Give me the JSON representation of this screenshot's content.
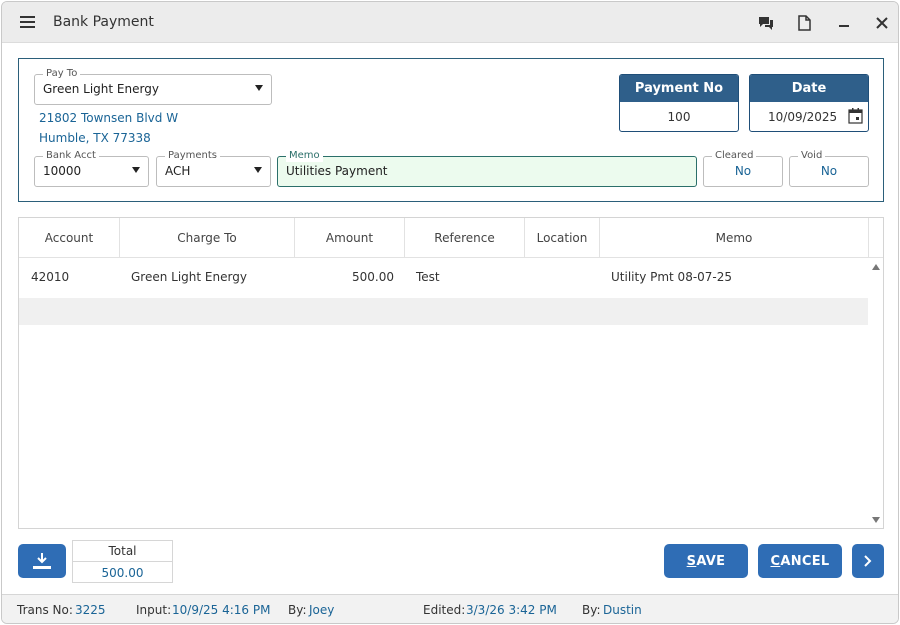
{
  "window": {
    "title": "Bank Payment"
  },
  "pay_to": {
    "legend": "Pay To",
    "value": "Green Light Energy",
    "address_line1": "21802 Townsen Blvd W",
    "address_line2": "Humble, TX 77338"
  },
  "payment_no": {
    "label": "Payment No",
    "value": "100"
  },
  "date": {
    "label": "Date",
    "value": "10/09/2025"
  },
  "bank_acct": {
    "legend": "Bank Acct",
    "value": "10000"
  },
  "payments": {
    "legend": "Payments",
    "value": "ACH"
  },
  "memo": {
    "legend": "Memo",
    "value": "Utilities Payment"
  },
  "cleared": {
    "legend": "Cleared",
    "value": "No"
  },
  "void": {
    "legend": "Void",
    "value": "No"
  },
  "grid": {
    "columns": [
      "Account",
      "Charge To",
      "Amount",
      "Reference",
      "Location",
      "Memo"
    ],
    "rows": [
      {
        "account": "42010",
        "charge_to": "Green Light Energy",
        "amount": "500.00",
        "reference": "Test",
        "location": "",
        "memo": "Utility Pmt 08-07-25"
      }
    ]
  },
  "totals": {
    "label": "Total",
    "value": "500.00"
  },
  "buttons": {
    "save_first": "S",
    "save_rest": "AVE",
    "cancel_first": "C",
    "cancel_rest": "ANCEL"
  },
  "footer": {
    "trans_no_label": "Trans No:",
    "trans_no": "3225",
    "input_label": "Input:",
    "input_value": "10/9/25 4:16 PM",
    "input_by_label": "By:",
    "input_by": "Joey",
    "edited_label": "Edited:",
    "edited_value": "3/3/26 3:42 PM",
    "edited_by_label": "By:",
    "edited_by": "Dustin"
  },
  "colors": {
    "accent": "#2f6db5",
    "header_caption": "#2f5f8a",
    "link": "#1a6496",
    "memo_bg": "#ecfbee"
  },
  "icons": [
    "menu-icon",
    "chat-icon",
    "document-icon",
    "minimize-icon",
    "close-icon",
    "calendar-icon",
    "download-icon",
    "chevron-right-icon"
  ]
}
